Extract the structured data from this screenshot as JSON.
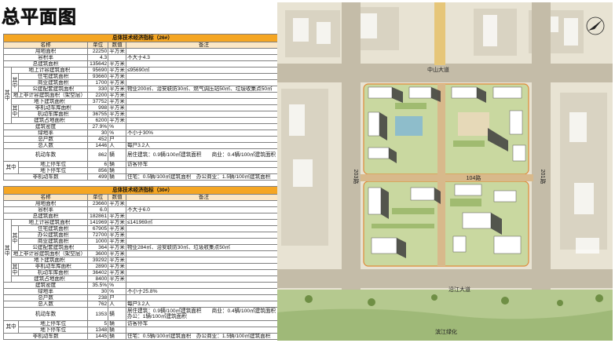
{
  "page_title": "总平面图",
  "table1": {
    "title": "总体技术经济指标（26#）",
    "headers": {
      "name": "名称",
      "unit": "单位",
      "value": "数值",
      "note": "备注"
    },
    "rows": [
      {
        "l": "用地面积",
        "v": "22250",
        "u": "平方米",
        "n": ""
      },
      {
        "l": "容积率",
        "v": "4.3",
        "u": "",
        "n": "不大于4.3"
      },
      {
        "l": "总建筑面积",
        "v": "135642",
        "u": "平方米",
        "n": ""
      },
      {
        "l": "地上计容建筑面积",
        "v": "95690",
        "u": "平方米",
        "n": "≤95690㎡"
      },
      {
        "l": "住宅建筑面积",
        "v": "93660",
        "u": "平方米",
        "n": ""
      },
      {
        "l": "商业建筑面积",
        "v": "1700",
        "u": "平方米",
        "n": ""
      },
      {
        "l": "公建配套建筑面积",
        "v": "330",
        "u": "平方米",
        "n": "物业200㎡、治安联防30㎡、燃气调压站50㎡、垃圾收集点50㎡"
      },
      {
        "l": "地上非计容建筑面积（架空层）",
        "v": "2200",
        "u": "平方米",
        "n": ""
      },
      {
        "l": "地下建筑面积",
        "v": "37752",
        "u": "平方米",
        "n": ""
      },
      {
        "l": "非机动车库面积",
        "v": "998",
        "u": "平方米",
        "n": ""
      },
      {
        "l": "机动车库面积",
        "v": "36755",
        "u": "平方米",
        "n": ""
      },
      {
        "l": "建筑占地面积",
        "v": "6200",
        "u": "平方米",
        "n": ""
      },
      {
        "l": "建筑密度",
        "v": "27.9%",
        "u": "%",
        "n": ""
      },
      {
        "l": "绿地率",
        "v": "30",
        "u": "%",
        "n": "不小于30%"
      },
      {
        "l": "总户数",
        "v": "452",
        "u": "户",
        "n": ""
      },
      {
        "l": "总人数",
        "v": "1446",
        "u": "人",
        "n": "每户3.2人"
      },
      {
        "l": "机动车数",
        "v": "862",
        "u": "辆",
        "n": "居住建筑：0.9辆/100㎡建筑面积　　商业：0.4辆/100㎡建筑面积"
      },
      {
        "l": "地上停车位",
        "v": "6",
        "u": "辆",
        "n": "访客停车"
      },
      {
        "l": "地下停车位",
        "v": "856",
        "u": "辆",
        "n": ""
      },
      {
        "l": "非机动车数",
        "v": "499",
        "u": "辆",
        "n": "住宅：0.5辆/100㎡建筑面积　办公商业：1.5辆/100㎡建筑面积"
      }
    ]
  },
  "table2": {
    "title": "总体技术经济指标（30#）",
    "headers": {
      "name": "名称",
      "unit": "单位",
      "value": "数值",
      "note": "备注"
    },
    "rows": [
      {
        "l": "用地面积",
        "v": "23660",
        "u": "平方米",
        "n": ""
      },
      {
        "l": "容积率",
        "v": "6.0",
        "u": "",
        "n": "不大于6.0"
      },
      {
        "l": "总建筑面积",
        "v": "182861",
        "u": "平方米",
        "n": ""
      },
      {
        "l": "地上计容建筑面积",
        "v": "141969",
        "u": "平方米",
        "n": "≤141969㎡"
      },
      {
        "l": "住宅建筑面积",
        "v": "67905",
        "u": "平方米",
        "n": ""
      },
      {
        "l": "办公建筑面积",
        "v": "72700",
        "u": "平方米",
        "n": ""
      },
      {
        "l": "商业建筑面积",
        "v": "1000",
        "u": "平方米",
        "n": ""
      },
      {
        "l": "公建配套建筑面积",
        "v": "364",
        "u": "平方米",
        "n": "物业284㎡、治安联防30㎡、垃圾收集点50㎡"
      },
      {
        "l": "地上非计容建筑面积（架空层）",
        "v": "3600",
        "u": "平方米",
        "n": ""
      },
      {
        "l": "地下建筑面积",
        "v": "39292",
        "u": "平方米",
        "n": ""
      },
      {
        "l": "非机动车库面积",
        "v": "2890",
        "u": "平方米",
        "n": ""
      },
      {
        "l": "机动车库面积",
        "v": "36402",
        "u": "平方米",
        "n": ""
      },
      {
        "l": "建筑占地面积",
        "v": "8400",
        "u": "平方米",
        "n": ""
      },
      {
        "l": "建筑密度",
        "v": "35.5%",
        "u": "%",
        "n": ""
      },
      {
        "l": "绿地率",
        "v": "30",
        "u": "%",
        "n": "不小于25.8%"
      },
      {
        "l": "总户数",
        "v": "238",
        "u": "户",
        "n": ""
      },
      {
        "l": "总人数",
        "v": "762",
        "u": "人",
        "n": "每户3.2人"
      },
      {
        "l": "机动车数",
        "v": "1353",
        "u": "辆",
        "n": "居住建筑：0.9辆/100㎡建筑面积　　商业：0.4辆/100㎡建筑面积 办公：1辆/100㎡建筑面积"
      },
      {
        "l": "地上停车位",
        "v": "5",
        "u": "辆",
        "n": "访客停车"
      },
      {
        "l": "地下停车位",
        "v": "1348",
        "u": "辆",
        "n": ""
      },
      {
        "l": "非机动车数",
        "v": "1445",
        "u": "辆",
        "n": "住宅：0.5辆/100㎡建筑面积　办公商业：1.5辆/100㎡建筑面积"
      }
    ]
  },
  "groups": {
    "qizhong": "其中"
  },
  "map": {
    "roads": {
      "north": "中山大道",
      "south": "沿江大道",
      "west": "203路",
      "east": "201路",
      "middle": "104路",
      "park": "滨江绿化"
    }
  }
}
